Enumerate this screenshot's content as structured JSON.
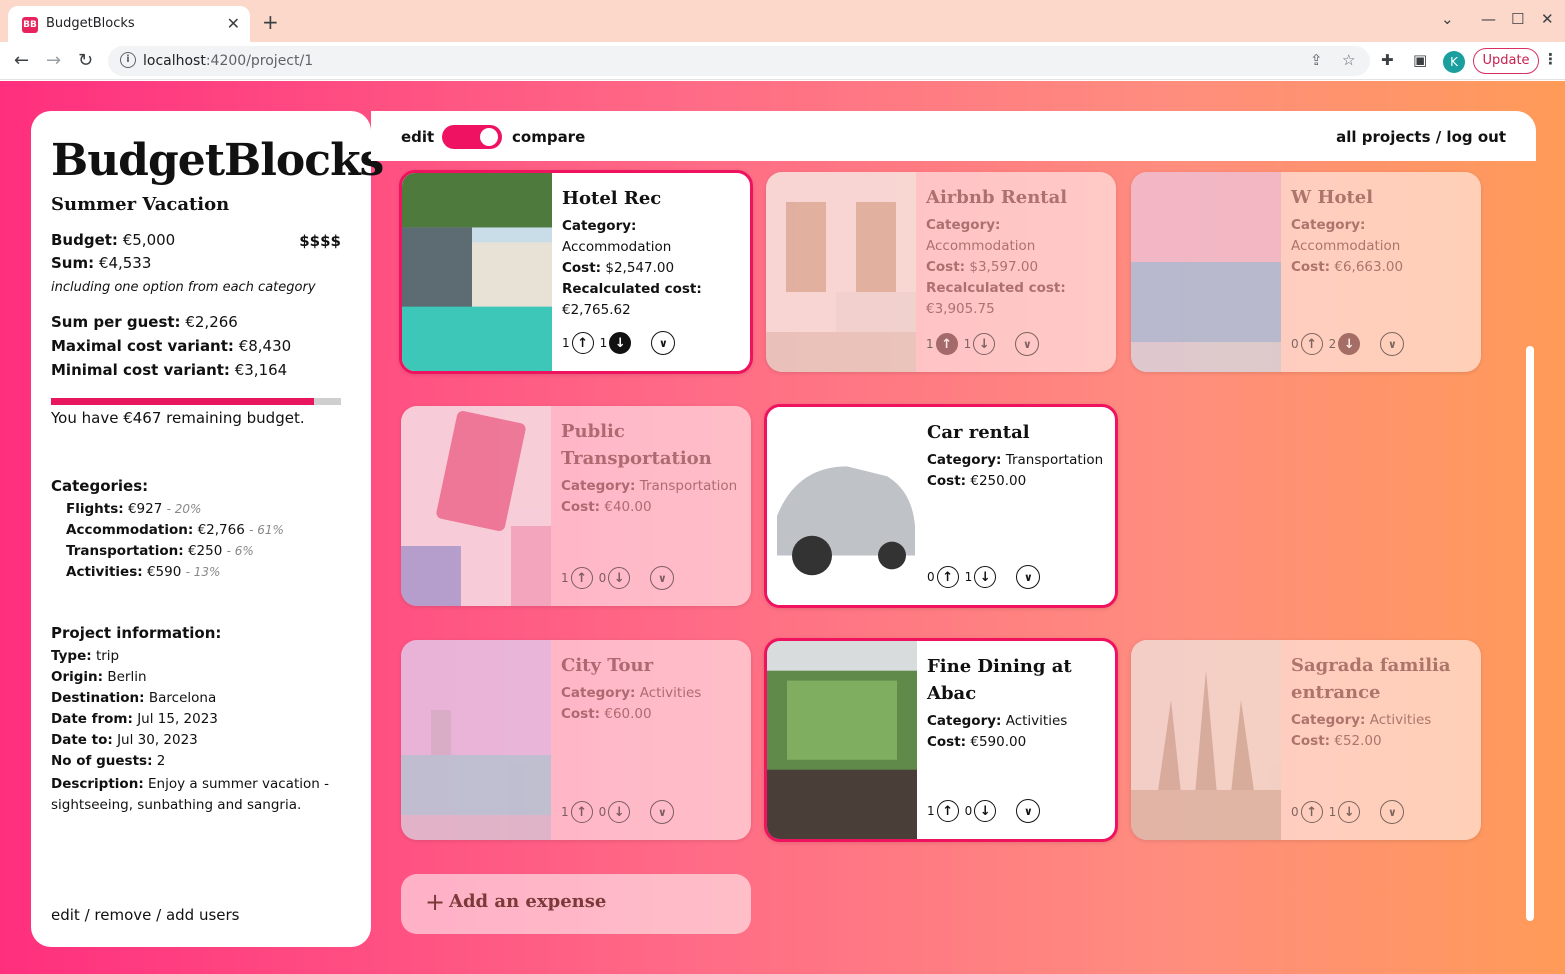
{
  "browser": {
    "tab_title": "BudgetBlocks",
    "favicon_text": "BB",
    "url_host": "localhost",
    "url_path": ":4200/project/1",
    "update_label": "Update",
    "avatar_letter": "K"
  },
  "sidebar": {
    "app_title": "BudgetBlocks",
    "project_name": "Summer Vacation",
    "budget_label": "Budget:",
    "budget_value": "€5,000",
    "price_level": "$$$$",
    "sum_label": "Sum:",
    "sum_value": "€4,533",
    "sum_note": "including one option from each category",
    "per_guest_label": "Sum per guest:",
    "per_guest_value": "€2,266",
    "max_label": "Maximal cost variant:",
    "max_value": "€8,430",
    "min_label": "Minimal cost variant:",
    "min_value": "€3,164",
    "budget_used_fraction": 0.907,
    "remaining_text": "You have €467 remaining budget.",
    "categories_title": "Categories:",
    "categories": [
      {
        "name": "Flights:",
        "value": "€927",
        "pct": "- 20%"
      },
      {
        "name": "Accommodation:",
        "value": "€2,766",
        "pct": "- 61%"
      },
      {
        "name": "Transportation:",
        "value": "€250",
        "pct": "- 6%"
      },
      {
        "name": "Activities:",
        "value": "€590",
        "pct": "- 13%"
      }
    ],
    "info_title": "Project information:",
    "info": [
      {
        "label": "Type:",
        "value": "trip"
      },
      {
        "label": "Origin:",
        "value": "Berlin"
      },
      {
        "label": "Destination:",
        "value": "Barcelona"
      },
      {
        "label": "Date from:",
        "value": "Jul 15, 2023"
      },
      {
        "label": "Date to:",
        "value": "Jul 30, 2023"
      },
      {
        "label": "No of guests:",
        "value": "2"
      }
    ],
    "description_label": "Description:",
    "description_value": "Enjoy a summer vacation - sightseeing, sunbathing and sangria.",
    "footer_links": "edit / remove / add users"
  },
  "topbar": {
    "edit_label": "edit",
    "compare_label": "compare",
    "links": "all projects / log out"
  },
  "labels": {
    "category": "Category:",
    "cost": "Cost:",
    "recalculated": "Recalculated cost:"
  },
  "cards": [
    {
      "title": "Hotel Rec",
      "category": "Accommodation",
      "cost": "$2,547.00",
      "recalc": "€2,765.62",
      "up": "1",
      "down": "1"
    },
    {
      "title": "Airbnb Rental",
      "category": "Accommodation",
      "cost": "$3,597.00",
      "recalc": "€3,905.75",
      "up": "1",
      "down": "1"
    },
    {
      "title": "W Hotel",
      "category": "Accommodation",
      "cost": "€6,663.00",
      "up": "0",
      "down": "2"
    },
    {
      "title": "Public Transportation",
      "category": "Transportation",
      "cost": "€40.00",
      "up": "1",
      "down": "0"
    },
    {
      "title": "Car rental",
      "category": "Transportation",
      "cost": "€250.00",
      "up": "0",
      "down": "1"
    },
    {
      "title": "City Tour",
      "category": "Activities",
      "cost": "€60.00",
      "up": "1",
      "down": "0"
    },
    {
      "title": "Fine Dining at Abac",
      "category": "Activities",
      "cost": "€590.00",
      "up": "1",
      "down": "0"
    },
    {
      "title": "Sagrada familia entrance",
      "category": "Activities",
      "cost": "€52.00",
      "up": "0",
      "down": "1"
    }
  ],
  "add_expense_label": "Add an expense",
  "colors": {
    "accent": "#ee125f",
    "bg_start": "#ff2f7e",
    "bg_end": "#ff9b58"
  }
}
